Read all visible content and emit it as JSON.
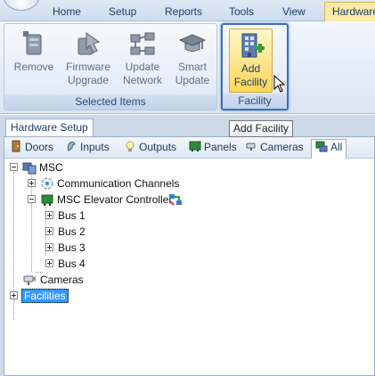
{
  "menu": {
    "tabs": [
      "Home",
      "Setup",
      "Reports",
      "Tools",
      "View",
      "Hardware"
    ],
    "active_tab": "Hardware"
  },
  "ribbon": {
    "selected_items_group": {
      "label": "Selected Items",
      "buttons": [
        {
          "line1": "Remove",
          "line2": "",
          "icon": "remove-icon"
        },
        {
          "line1": "Firmware",
          "line2": "Upgrade",
          "icon": "firmware-upgrade-icon"
        },
        {
          "line1": "Update",
          "line2": "Network",
          "icon": "update-network-icon"
        },
        {
          "line1": "Smart",
          "line2": "Update",
          "icon": "smart-update-icon"
        }
      ]
    },
    "facility_group": {
      "label": "Facility",
      "button": {
        "line1": "Add",
        "line2": "Facility",
        "icon": "add-facility-icon"
      }
    }
  },
  "tooltip": "Add Facility",
  "panel": {
    "tab_label": "Hardware Setup",
    "filters": [
      "Doors",
      "Inputs",
      "Outputs",
      "Panels",
      "Cameras",
      "All"
    ],
    "active_filter": "All"
  },
  "tree": {
    "root": "MSC",
    "communication_channels": "Communication Channels",
    "controller": "MSC Elevator Controller",
    "buses": [
      "Bus 1",
      "Bus 2",
      "Bus 3",
      "Bus 4"
    ],
    "cameras": "Cameras",
    "facilities": "Facilities"
  },
  "colors": {
    "accent": "#3d6fb7",
    "selection": "#3399ff",
    "active_tab": "#fbe9a9"
  }
}
